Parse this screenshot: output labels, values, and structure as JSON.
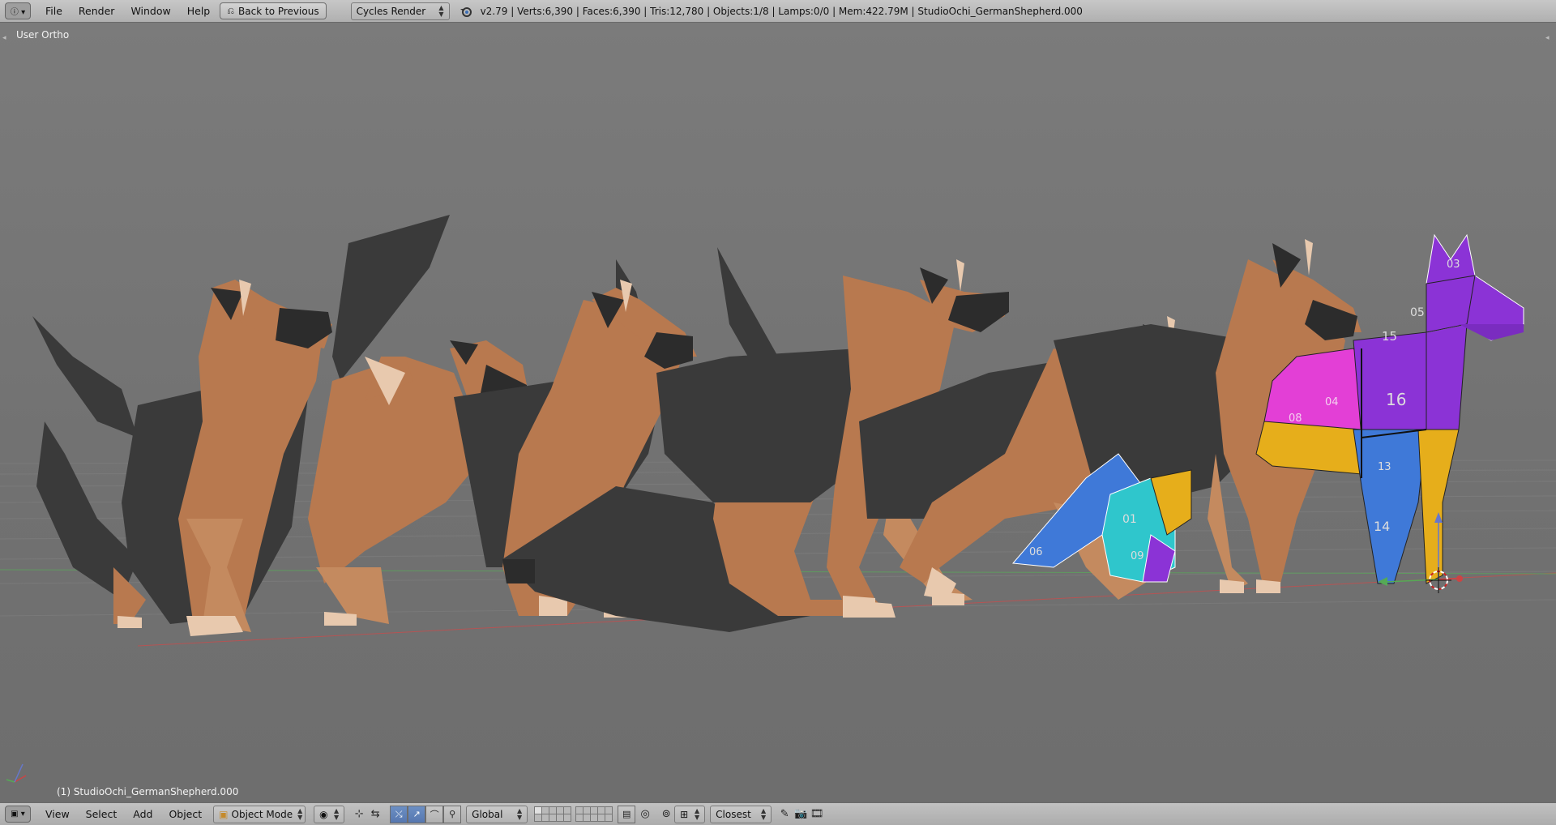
{
  "topbar": {
    "menus": [
      "File",
      "Render",
      "Window",
      "Help"
    ],
    "back_button": "Back to Previous",
    "render_engine": "Cycles Render",
    "stats": "v2.79 | Verts:6,390 | Faces:6,390 | Tris:12,780 | Objects:1/8 | Lamps:0/0 | Mem:422.79M | StudioOchi_GermanShepherd.000"
  },
  "viewport": {
    "view_name": "User Ortho",
    "active_object": "(1) StudioOchi_GermanShepherd.000",
    "uv_numbers": [
      "03",
      "05",
      "15",
      "16",
      "04",
      "08",
      "13",
      "14",
      "01",
      "09",
      "06"
    ]
  },
  "bottombar": {
    "menus": [
      "View",
      "Select",
      "Add",
      "Object"
    ],
    "mode": "Object Mode",
    "orientation": "Global",
    "snap_target": "Closest"
  },
  "colors": {
    "background": "#727272",
    "dog_tan": "#b8794f",
    "dog_black": "#3a3a3a",
    "dog_cream": "#e8c9ae",
    "uv_purple": "#8b33d6",
    "uv_magenta": "#e33fd6",
    "uv_yellow": "#e6ae1b",
    "uv_blue": "#3f79d8",
    "uv_cyan": "#2fc6cc"
  }
}
